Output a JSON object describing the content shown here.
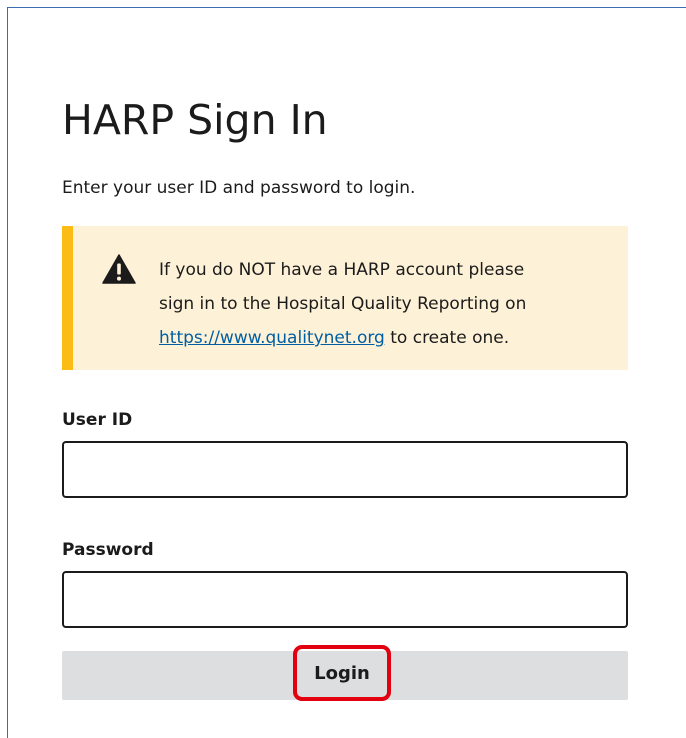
{
  "page": {
    "title": "HARP Sign In",
    "subtitle": "Enter your user ID and password to login."
  },
  "alert": {
    "icon": "warning-icon",
    "line1": "If you do NOT have a HARP account please",
    "line2": "sign in to the Hospital Quality Reporting on",
    "link_text": "https://www.qualitynet.org",
    "line3_suffix": " to create one."
  },
  "form": {
    "user_id_label": "User ID",
    "user_id_value": "",
    "password_label": "Password",
    "password_value": "",
    "login_label": "Login"
  },
  "colors": {
    "alert_background": "#fdf1d7",
    "alert_accent": "#fbbd15",
    "link": "#005ea2",
    "highlight": "#e3000f",
    "button": "#dcdee0"
  }
}
